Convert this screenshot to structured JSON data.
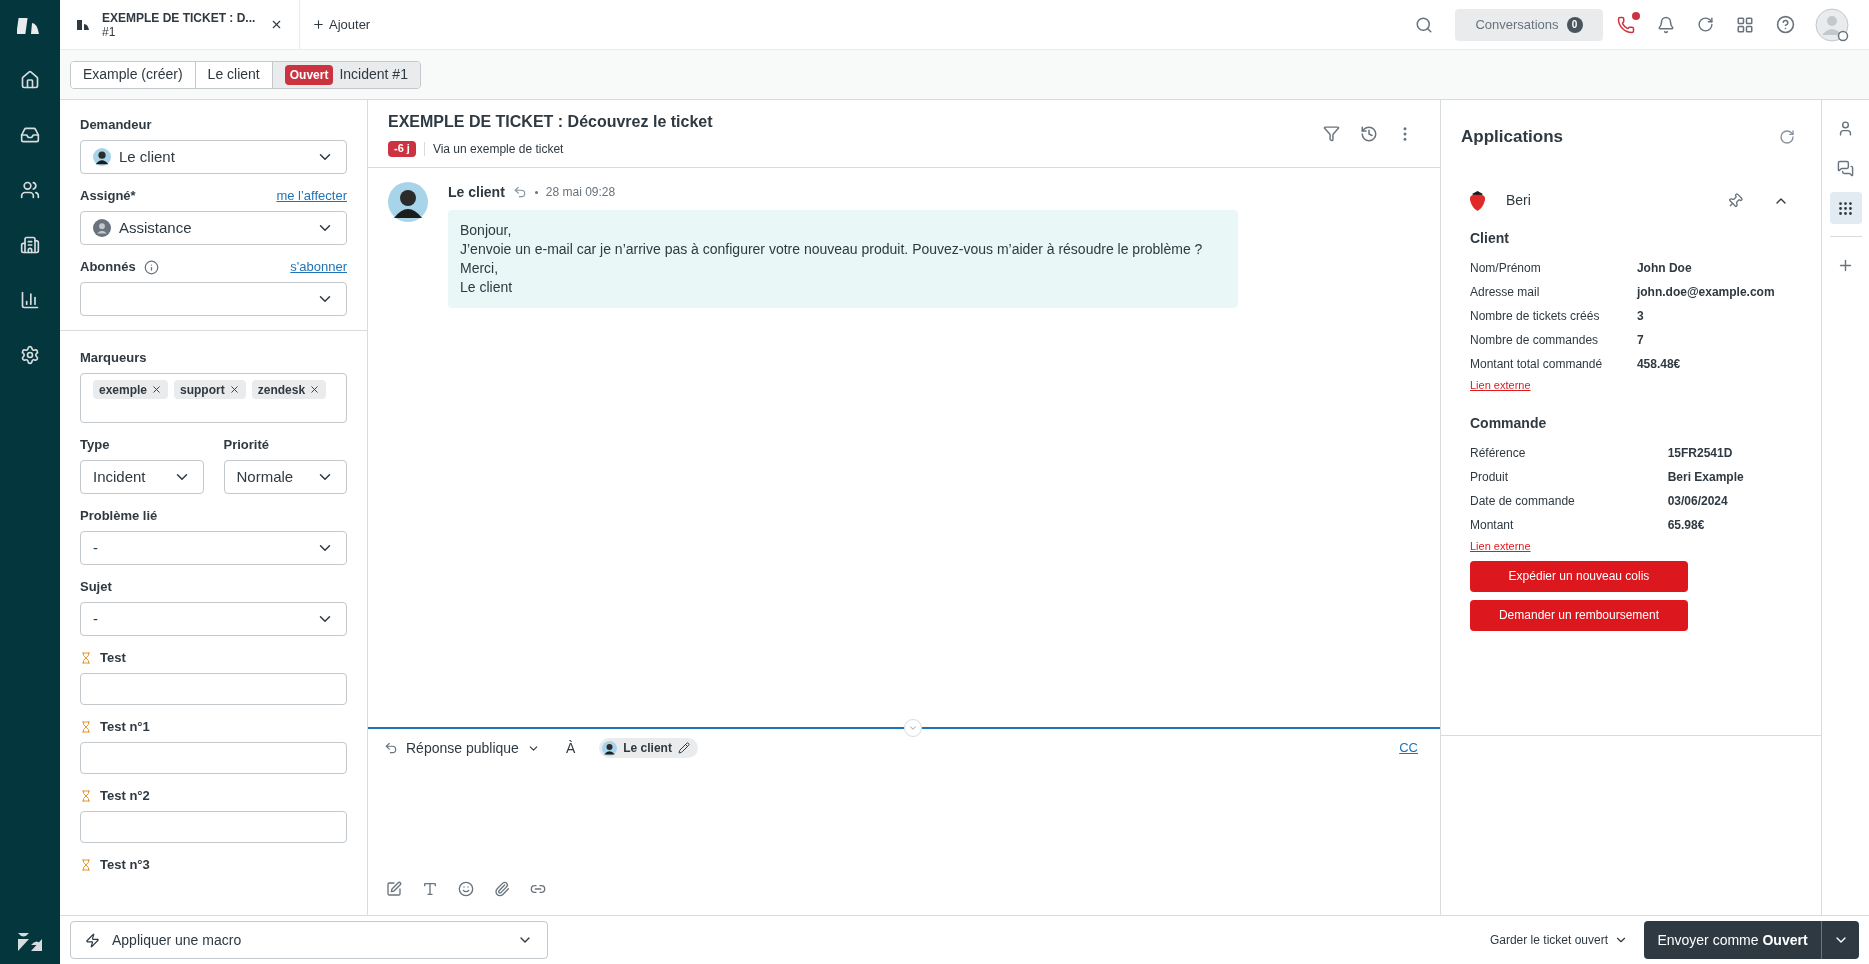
{
  "top_bar": {
    "ticket_tab": {
      "title": "EXEMPLE DE TICKET : D...",
      "subtitle": "#1"
    },
    "add_tab": "Ajouter",
    "conversations": {
      "label": "Conversations",
      "count": "0"
    },
    "phone_alert": true
  },
  "breadcrumbs": [
    {
      "kind": "text",
      "label": "Example (créer)"
    },
    {
      "kind": "text",
      "label": "Le client"
    },
    {
      "kind": "status",
      "badge": "Ouvert",
      "label": "Incident #1",
      "color": "#cc3340"
    }
  ],
  "left_sections": [
    [
      {
        "kind": "user_select",
        "label": "Demandeur",
        "value": "Le client"
      },
      {
        "kind": "agent_select",
        "label": "Assigné*",
        "link": "me l’affecter",
        "value": "Assistance"
      },
      {
        "kind": "select",
        "label": "Abonnés",
        "info": true,
        "link": "s'abonner"
      }
    ],
    [
      {
        "kind": "tags",
        "label": "Marqueurs",
        "tags": [
          "exemple",
          "support",
          "zendesk"
        ]
      },
      {
        "kind": "pair",
        "fields": [
          {
            "label": "Type",
            "value": "Incident"
          },
          {
            "label": "Priorité",
            "value": "Normale"
          }
        ]
      },
      {
        "kind": "select",
        "label": "Problème lié",
        "value": "-"
      },
      {
        "kind": "select",
        "label": "Sujet",
        "value": "-"
      },
      {
        "kind": "input",
        "label": "Test",
        "timer": true
      },
      {
        "kind": "input",
        "label": "Test n°1",
        "timer": true
      },
      {
        "kind": "input",
        "label": "Test n°2",
        "timer": true
      },
      {
        "kind": "label",
        "label": "Test n°3",
        "timer": true
      }
    ]
  ],
  "conversation": {
    "title": "EXEMPLE DE TICKET : Découvrez le ticket",
    "age_badge": "-6 j",
    "via": "Via un exemple de ticket",
    "messages": [
      {
        "author": "Le client",
        "time": "28 mai 09:28",
        "lines": [
          "Bonjour,",
          "J’envoie un e-mail car je n’arrive pas à configurer votre nouveau produit. Pouvez-vous m’aider à résoudre le problème ?",
          "Merci,",
          "Le client"
        ]
      }
    ]
  },
  "composer": {
    "mode": "Réponse publique",
    "to_label": "À",
    "recipient": "Le client",
    "cc": "CC"
  },
  "apps": {
    "title": "Applications",
    "app": {
      "name": "Beri",
      "expanded": true,
      "sections": [
        {
          "title": "Client",
          "rows": [
            {
              "label": "Nom/Prénom",
              "value": "John Doe"
            },
            {
              "label": "Adresse mail",
              "value": "john.doe@example.com"
            },
            {
              "label": "Nombre de tickets créés",
              "value": "3"
            },
            {
              "label": "Nombre de commandes",
              "value": "7"
            },
            {
              "label": "Montant total commandé",
              "value": "458.48€"
            }
          ],
          "link": "Lien externe"
        },
        {
          "title": "Commande",
          "rows": [
            {
              "label": "Référence",
              "value": "15FR2541D"
            },
            {
              "label": "Produit",
              "value": "Beri Example"
            },
            {
              "label": "Date de commande",
              "value": "03/06/2024"
            },
            {
              "label": "Montant",
              "value": "65.98€"
            }
          ],
          "link": "Lien externe"
        }
      ],
      "buttons": [
        "Expédier un nouveau colis",
        "Demander un remboursement"
      ]
    }
  },
  "side_tools": [
    {
      "kind": "user",
      "selected": false
    },
    {
      "kind": "chat",
      "selected": false
    },
    {
      "kind": "apps",
      "selected": true
    },
    {
      "kind": "add",
      "selected": false
    }
  ],
  "nav": [
    {
      "kind": "home",
      "selected": false
    },
    {
      "kind": "views",
      "selected": false
    },
    {
      "kind": "users",
      "selected": false
    },
    {
      "kind": "orgs",
      "selected": false
    },
    {
      "kind": "reports",
      "selected": false
    },
    {
      "kind": "settings",
      "selected": false
    }
  ],
  "footer": {
    "macro": "Appliquer une macro",
    "keep_open": "Garder le ticket ouvert",
    "submit": "Envoyer comme **Ouvert**"
  }
}
